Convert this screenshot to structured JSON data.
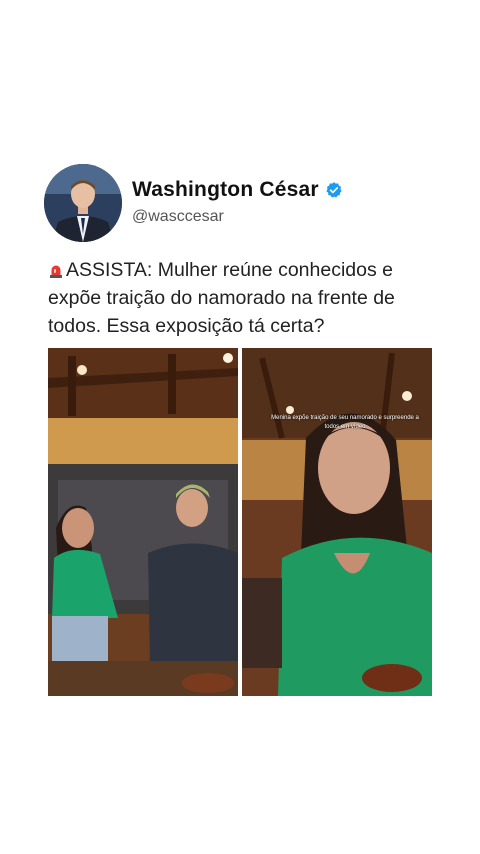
{
  "author": {
    "name": "Washington César",
    "handle": "@wasccesar",
    "verified": true
  },
  "post": {
    "text": "ASSISTA: Mulher reúne conhecidos e expõe traição do namorado na frente de todos. Essa exposição tá certa?",
    "leading_icon": "siren-icon"
  },
  "media": {
    "left_frame": {
      "description_icon": "video-frame"
    },
    "right_frame": {
      "overlay_caption": "Menina expõe traição de seu namorado e surpreende a todos em vídeo"
    }
  },
  "colors": {
    "verified": "#1d9bf0",
    "text": "#222222",
    "handle": "#555555",
    "background": "#ffffff"
  }
}
